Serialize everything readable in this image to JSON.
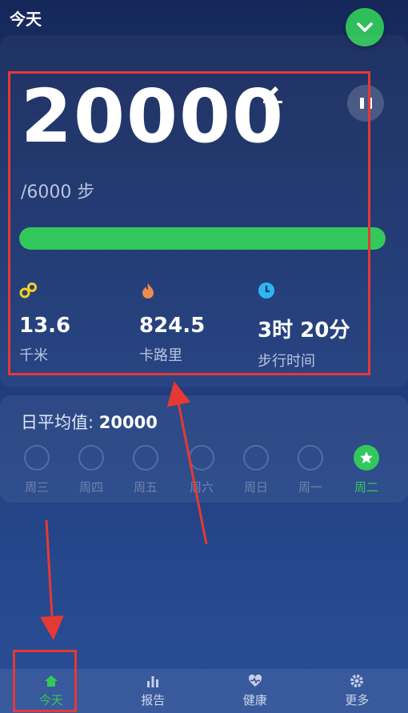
{
  "header": {
    "title": "今天"
  },
  "steps": {
    "value": "20000",
    "goal": "/6000 步",
    "progress": 1.0
  },
  "stats": [
    {
      "icon": "distance-icon",
      "value": "13.6",
      "label": "千米",
      "color": "#f4d01e"
    },
    {
      "icon": "flame-icon",
      "value": "824.5",
      "label": "卡路里",
      "color": "#f08a4b"
    },
    {
      "icon": "clock-icon",
      "value": "3时 20分",
      "label": "步行时间",
      "color": "#2fb6f0"
    }
  ],
  "week": {
    "avg_label": "日平均值:",
    "avg_value": "20000",
    "days": [
      {
        "label": "周三",
        "active": false
      },
      {
        "label": "周四",
        "active": false
      },
      {
        "label": "周五",
        "active": false
      },
      {
        "label": "周六",
        "active": false
      },
      {
        "label": "周日",
        "active": false
      },
      {
        "label": "周一",
        "active": false
      },
      {
        "label": "周二",
        "active": true
      }
    ]
  },
  "nav": [
    {
      "icon": "home-icon",
      "label": "今天",
      "active": true
    },
    {
      "icon": "bar-chart-icon",
      "label": "报告",
      "active": false
    },
    {
      "icon": "heart-icon",
      "label": "健康",
      "active": false
    },
    {
      "icon": "gear-icon",
      "label": "更多",
      "active": false
    }
  ],
  "colors": {
    "accent": "#33c85c",
    "annotation": "#e53935"
  }
}
